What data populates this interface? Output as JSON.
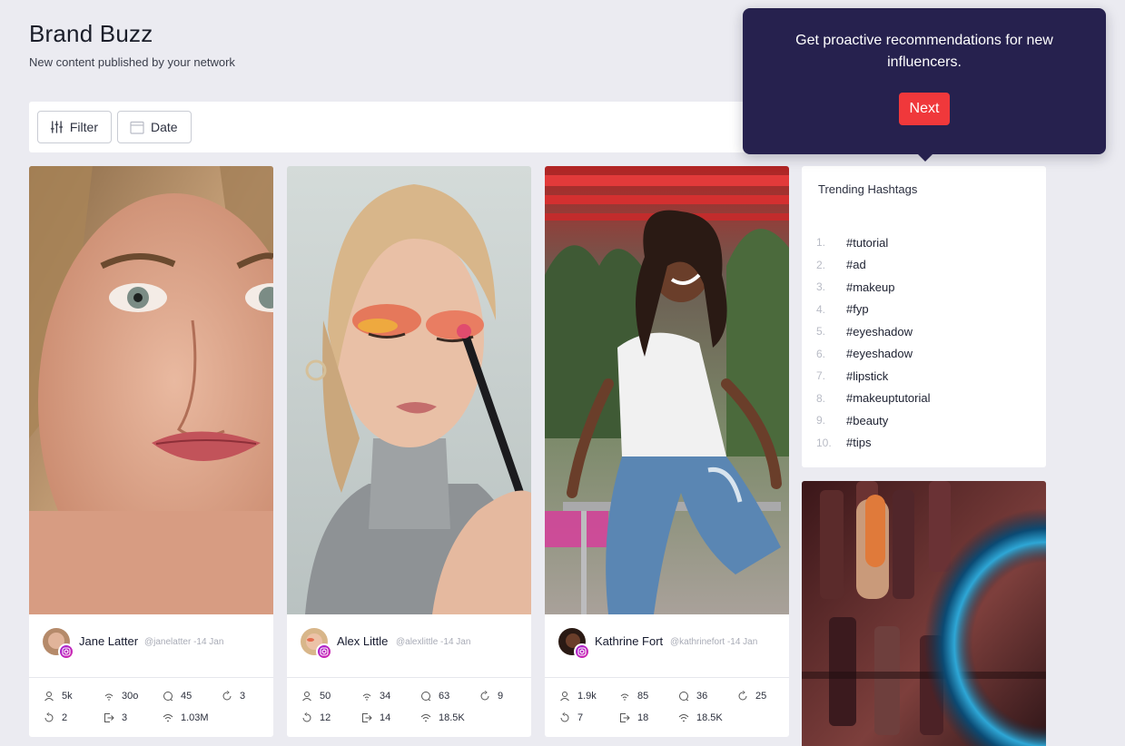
{
  "page": {
    "title": "Brand Buzz",
    "subtitle": "New content published by your network"
  },
  "toolbar": {
    "filter_label": "Filter",
    "date_label": "Date"
  },
  "posts": [
    {
      "author": "Jane Latter",
      "meta": "@janelatter -14 Jan",
      "stats": {
        "followers": "5k",
        "reach": "30o",
        "comments": "45",
        "shares": "3",
        "reposts": "2",
        "forwards": "3",
        "impressions": "1.03M"
      }
    },
    {
      "author": "Alex Little",
      "meta": "@alexlittle -14 Jan",
      "stats": {
        "followers": "50",
        "reach": "34",
        "comments": "63",
        "shares": "9",
        "reposts": "12",
        "forwards": "14",
        "impressions": "18.5K"
      }
    },
    {
      "author": "Kathrine Fort",
      "meta": "@kathrinefort -14 Jan",
      "stats": {
        "followers": "1.9k",
        "reach": "85",
        "comments": "36",
        "shares": "25",
        "reposts": "7",
        "forwards": "18",
        "impressions": "18.5K"
      }
    }
  ],
  "trending": {
    "title": "Trending Hashtags",
    "items": [
      {
        "num": "1.",
        "tag": "#tutorial"
      },
      {
        "num": "2.",
        "tag": "#ad"
      },
      {
        "num": "3.",
        "tag": "#makeup"
      },
      {
        "num": "4.",
        "tag": "#fyp"
      },
      {
        "num": "5.",
        "tag": "#eyeshadow"
      },
      {
        "num": "6.",
        "tag": "#eyeshadow"
      },
      {
        "num": "7.",
        "tag": "#lipstick"
      },
      {
        "num": "8.",
        "tag": "#makeuptutorial"
      },
      {
        "num": "9.",
        "tag": "#beauty"
      },
      {
        "num": "10.",
        "tag": "#tips"
      }
    ]
  },
  "tooltip": {
    "text": "Get proactive recommendations for new influencers.",
    "next_label": "Next"
  },
  "colors": {
    "background": "#ebebf1",
    "tooltip_bg": "#26214e",
    "accent_red": "#f0383b",
    "instagram_badge": "#b026c9"
  },
  "icons": {
    "filter": "sliders-icon",
    "date": "calendar-icon",
    "followers": "user-icon",
    "reach": "wifi-icon",
    "comments": "comment-icon",
    "shares": "refresh-icon",
    "reposts": "undo-icon",
    "forwards": "share-out-icon",
    "impressions": "broadcast-icon",
    "platform": "instagram-icon"
  }
}
